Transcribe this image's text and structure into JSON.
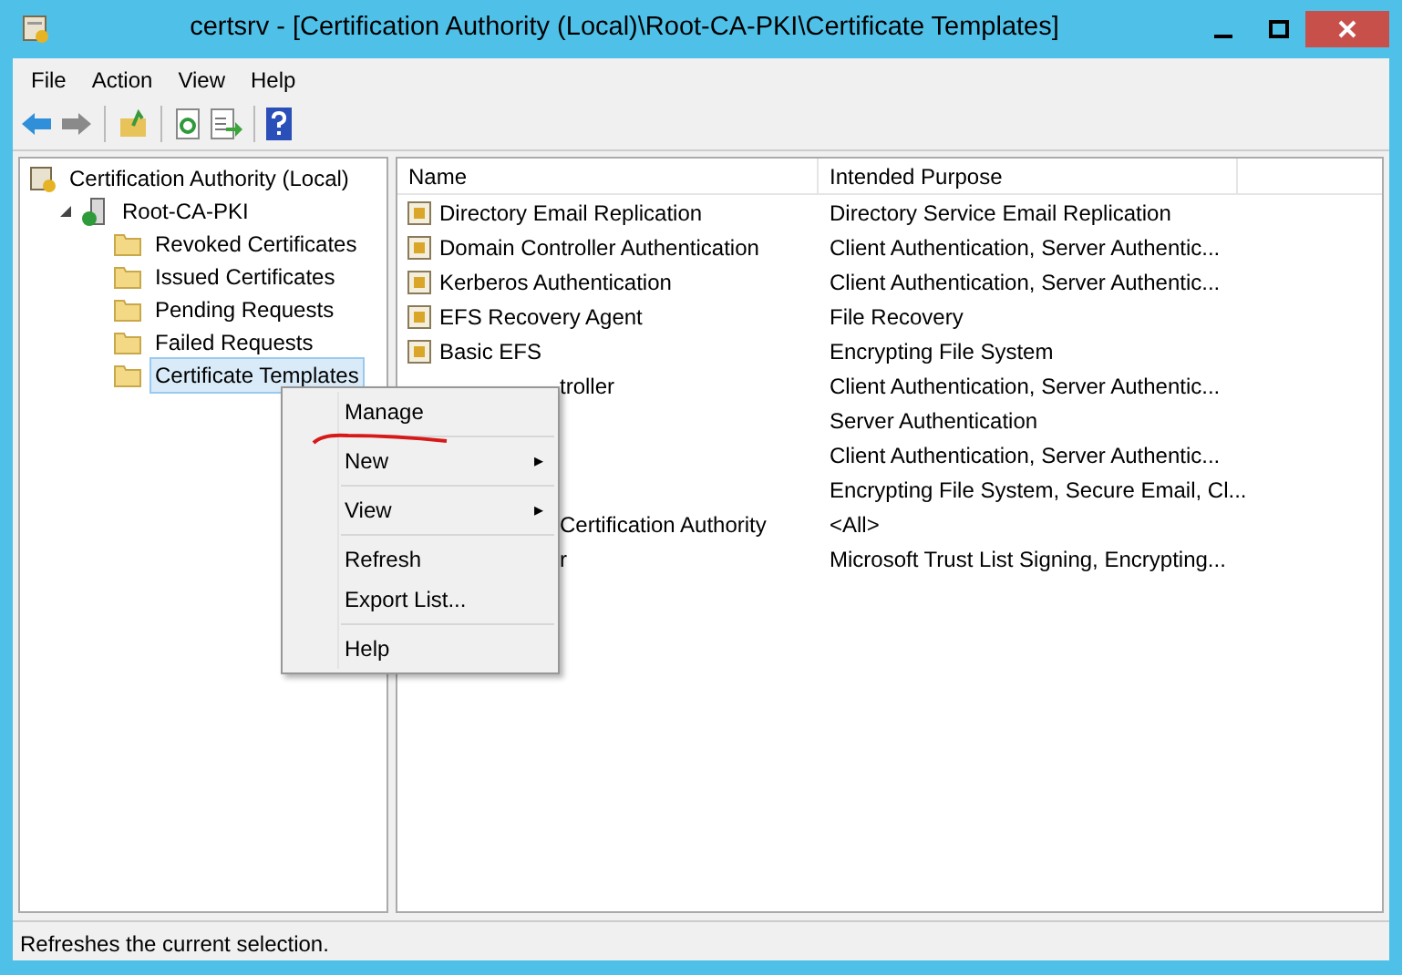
{
  "window": {
    "title": "certsrv - [Certification Authority (Local)\\Root-CA-PKI\\Certificate Templates]"
  },
  "menu_bar": [
    "File",
    "Action",
    "View",
    "Help"
  ],
  "tree": {
    "label": "Certification Authority (Local)",
    "kind": "root",
    "children": [
      {
        "label": "Root-CA-PKI",
        "kind": "server",
        "expanded": true,
        "selected": false,
        "children": [
          {
            "label": "Revoked Certificates",
            "kind": "folder",
            "selected": false
          },
          {
            "label": "Issued Certificates",
            "kind": "folder",
            "selected": false
          },
          {
            "label": "Pending Requests",
            "kind": "folder",
            "selected": false
          },
          {
            "label": "Failed Requests",
            "kind": "folder",
            "selected": false
          },
          {
            "label": "Certificate Templates",
            "kind": "folder",
            "selected": true
          }
        ]
      }
    ]
  },
  "table": {
    "columns": [
      "Name",
      "Intended Purpose"
    ],
    "rows": [
      {
        "name": "Directory Email Replication",
        "purpose": "Directory Service Email Replication"
      },
      {
        "name": "Domain Controller Authentication",
        "purpose": "Client Authentication, Server Authentic..."
      },
      {
        "name": "Kerberos Authentication",
        "purpose": "Client Authentication, Server Authentic..."
      },
      {
        "name": "EFS Recovery Agent",
        "purpose": "File Recovery"
      },
      {
        "name": "Basic EFS",
        "purpose": "Encrypting File System"
      },
      {
        "name_fragment": "troller",
        "purpose": "Client Authentication, Server Authentic..."
      },
      {
        "purpose": "Server Authentication"
      },
      {
        "purpose": "Client Authentication, Server Authentic..."
      },
      {
        "purpose": "Encrypting File System, Secure Email, Cl..."
      },
      {
        "name_fragment": "Certification Authority",
        "purpose": "<All>"
      },
      {
        "name_fragment": "r",
        "purpose": "Microsoft Trust List Signing, Encrypting..."
      }
    ]
  },
  "context_menu": [
    {
      "label": "Manage",
      "kind": "item",
      "annotated": true
    },
    {
      "kind": "separator"
    },
    {
      "label": "New",
      "kind": "submenu",
      "arrow": "▸"
    },
    {
      "kind": "separator"
    },
    {
      "label": "View",
      "kind": "submenu",
      "arrow": "▸"
    },
    {
      "kind": "separator"
    },
    {
      "label": "Refresh",
      "kind": "item"
    },
    {
      "label": "Export List...",
      "kind": "item"
    },
    {
      "kind": "separator"
    },
    {
      "label": "Help",
      "kind": "item"
    }
  ],
  "status_bar": "Refreshes the current selection."
}
